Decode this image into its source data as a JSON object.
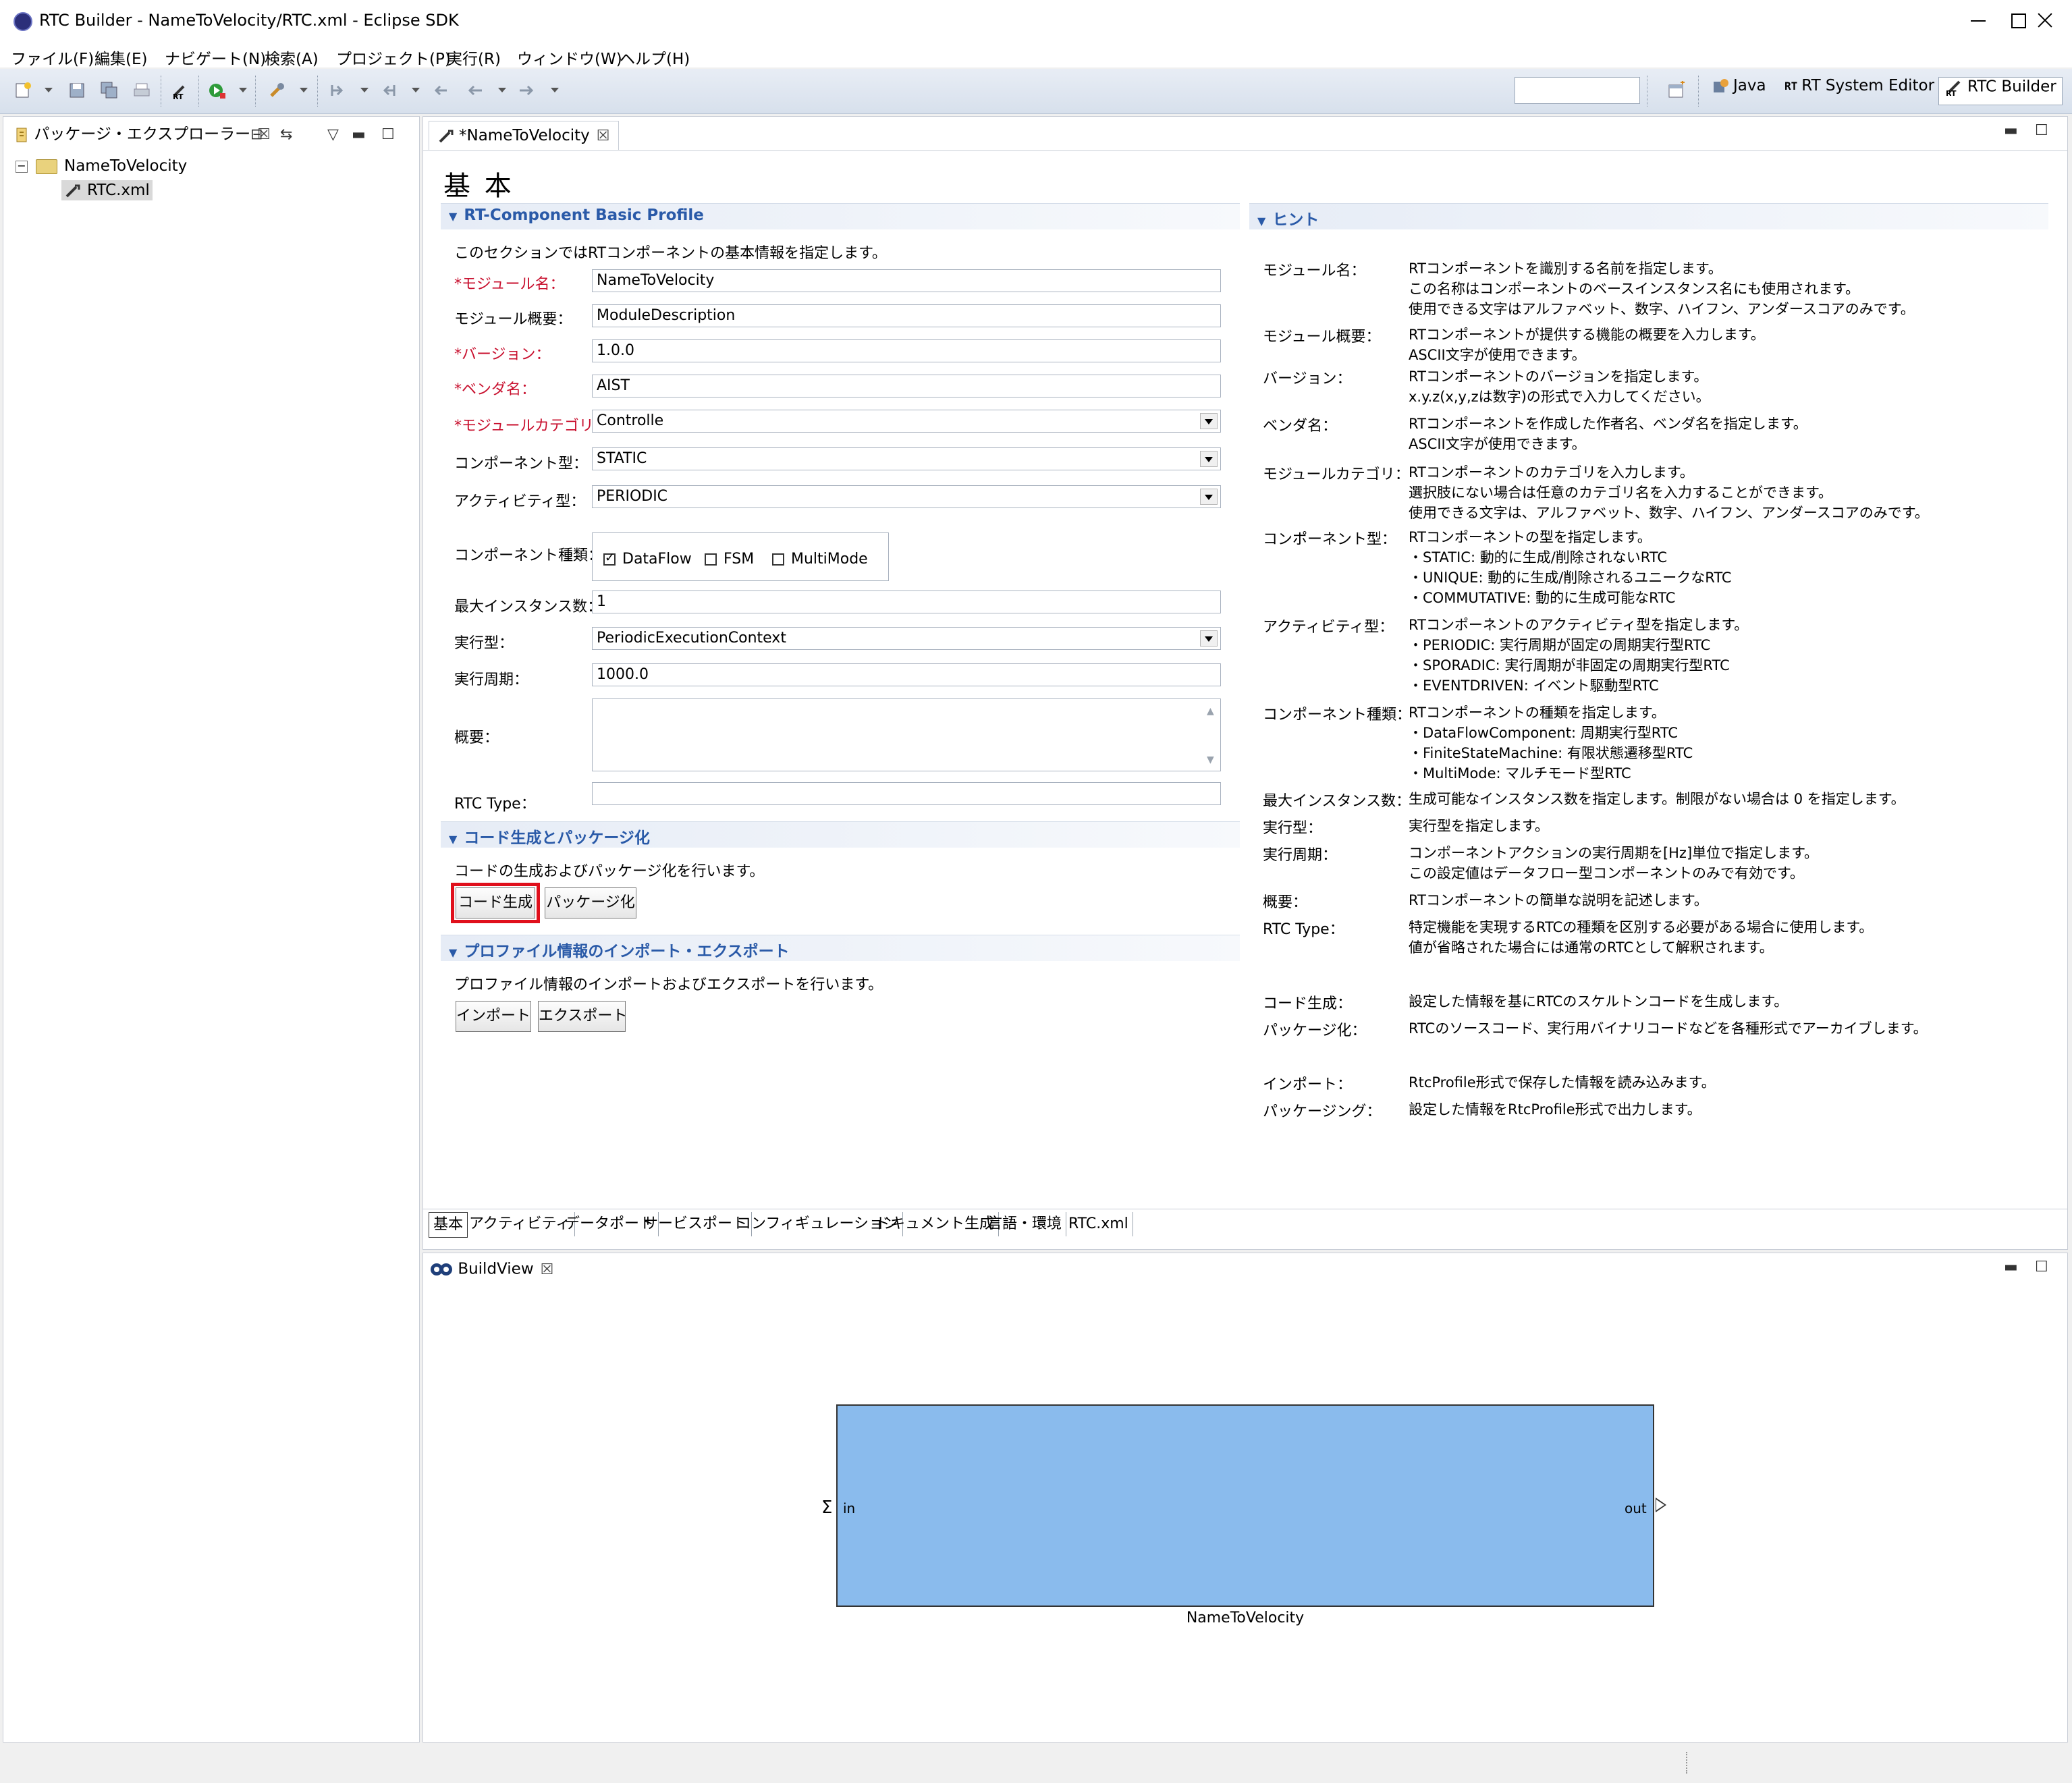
{
  "window": {
    "title": "RTC Builder - NameToVelocity/RTC.xml - Eclipse SDK"
  },
  "menu": [
    "ファイル(F)",
    "編集(E)",
    "ナビゲート(N)",
    "検索(A)",
    "プロジェクト(P)",
    "実行(R)",
    "ウィンドウ(W)",
    "ヘルプ(H)"
  ],
  "toolbar": {
    "quick_access_value": "",
    "perspectives": {
      "java": "Java",
      "rt_system_editor": "RT System Editor",
      "rtc_builder": "RTC Builder",
      "rt_glyph": "RT"
    }
  },
  "explorer": {
    "tab_label": "パッケージ・エクスプローラー",
    "project": "NameToVelocity",
    "file": "RTC.xml"
  },
  "editor": {
    "tab_label": "*NameToVelocity",
    "page_title": "基 本",
    "profile_section": {
      "title": "RT-Component Basic Profile",
      "description": "このセクションではRTコンポーネントの基本情報を指定します。",
      "labels": {
        "module_name": "*モジュール名：",
        "module_description": "モジュール概要：",
        "version": "*バージョン：",
        "vendor": "*ベンダ名：",
        "category": "*モジュールカテゴリ：",
        "component_type": "コンポーネント型：",
        "activity_type": "アクティビティ型：",
        "component_kind": "コンポーネント種類：",
        "max_instances": "最大インスタンス数：",
        "execution_type": "実行型：",
        "execution_rate": "実行周期：",
        "abstract": "概要：",
        "rtc_type": "RTC Type："
      },
      "values": {
        "module_name": "NameToVelocity",
        "module_description": "ModuleDescription",
        "version": "1.0.0",
        "vendor": "AIST",
        "category": "Controlle",
        "component_type": "STATIC",
        "activity_type": "PERIODIC",
        "max_instances": "1",
        "execution_type": "PeriodicExecutionContext",
        "execution_rate": "1000.0",
        "abstract": "",
        "rtc_type": ""
      },
      "kinds": [
        {
          "label": "DataFlow",
          "checked": true
        },
        {
          "label": "FSM",
          "checked": false
        },
        {
          "label": "MultiMode",
          "checked": false
        }
      ]
    },
    "codegen_section": {
      "title": "コード生成とパッケージ化",
      "description": "コードの生成およびパッケージ化を行います。",
      "generate_button": "コード生成",
      "package_button": "パッケージ化"
    },
    "import_section": {
      "title": "プロファイル情報のインポート・エクスポート",
      "description": "プロファイル情報のインポートおよびエクスポートを行います。",
      "import_button": "インポート",
      "export_button": "エクスポート"
    },
    "hint_section": {
      "title": "ヒント",
      "items": [
        {
          "label": "モジュール名：",
          "text": [
            "RTコンポーネントを識別する名前を指定します。",
            "この名称はコンポーネントのベースインスタンス名にも使用されます。",
            "使用できる文字はアルファベット、数字、ハイフン、アンダースコアのみです。"
          ]
        },
        {
          "label": "モジュール概要：",
          "text": [
            "RTコンポーネントが提供する機能の概要を入力します。",
            "ASCII文字が使用できます。"
          ]
        },
        {
          "label": "バージョン：",
          "text": [
            "RTコンポーネントのバージョンを指定します。",
            "x.y.z(x,y,zは数字)の形式で入力してください。"
          ]
        },
        {
          "label": "ベンダ名：",
          "text": [
            "RTコンポーネントを作成した作者名、ベンダ名を指定します。",
            "ASCII文字が使用できます。"
          ]
        },
        {
          "label": "モジュールカテゴリ：",
          "text": [
            "RTコンポーネントのカテゴリを入力します。",
            "選択肢にない場合は任意のカテゴリ名を入力することができます。",
            "使用できる文字は、アルファベット、数字、ハイフン、アンダースコアのみです。"
          ]
        },
        {
          "label": "コンポーネント型：",
          "text": [
            "RTコンポーネントの型を指定します。",
            "・STATIC: 動的に生成/削除されないRTC",
            "・UNIQUE: 動的に生成/削除されるユニークなRTC",
            "・COMMUTATIVE: 動的に生成可能なRTC"
          ]
        },
        {
          "label": "アクティビティ型：",
          "text": [
            "RTコンポーネントのアクティビティ型を指定します。",
            "・PERIODIC: 実行周期が固定の周期実行型RTC",
            "・SPORADIC: 実行周期が非固定の周期実行型RTC",
            "・EVENTDRIVEN: イベント駆動型RTC"
          ]
        },
        {
          "label": "コンポーネント種類：",
          "text": [
            "RTコンポーネントの種類を指定します。",
            "・DataFlowComponent: 周期実行型RTC",
            "・FiniteStateMachine: 有限状態遷移型RTC",
            "・MultiMode: マルチモード型RTC"
          ]
        },
        {
          "label": "最大インスタンス数：",
          "text": [
            "生成可能なインスタンス数を指定します。制限がない場合は 0 を指定します。"
          ]
        },
        {
          "label": "実行型：",
          "text": [
            "実行型を指定します。"
          ]
        },
        {
          "label": "実行周期：",
          "text": [
            "コンポーネントアクションの実行周期を[Hz]単位で指定します。",
            "この設定値はデータフロー型コンポーネントのみで有効です。"
          ]
        },
        {
          "label": "概要：",
          "text": [
            "RTコンポーネントの簡単な説明を記述します。"
          ]
        },
        {
          "label": "RTC Type：",
          "text": [
            "特定機能を実現するRTCの種類を区別する必要がある場合に使用します。",
            "値が省略された場合には通常のRTCとして解釈されます。"
          ]
        },
        {
          "label": "コード生成：",
          "text": [
            "設定した情報を基にRTCのスケルトンコードを生成します。"
          ]
        },
        {
          "label": "パッケージ化：",
          "text": [
            "RTCのソースコード、実行用バイナリコードなどを各種形式でアーカイブします。"
          ]
        },
        {
          "label": "インポート：",
          "text": [
            "RtcProfile形式で保存した情報を読み込みます。"
          ]
        },
        {
          "label": "パッケージング：",
          "text": [
            "設定した情報をRtcProfile形式で出力します。"
          ]
        }
      ]
    },
    "bottom_tabs": [
      "基本",
      "アクティビティ",
      "データポート",
      "サービスポート",
      "コンフィギュレーション",
      "ドキュメント生成",
      "言語・環境",
      "RTC.xml"
    ]
  },
  "buildview": {
    "tab_label": "BuildView",
    "component_name": "NameToVelocity",
    "in_port": "in",
    "out_port": "out"
  }
}
